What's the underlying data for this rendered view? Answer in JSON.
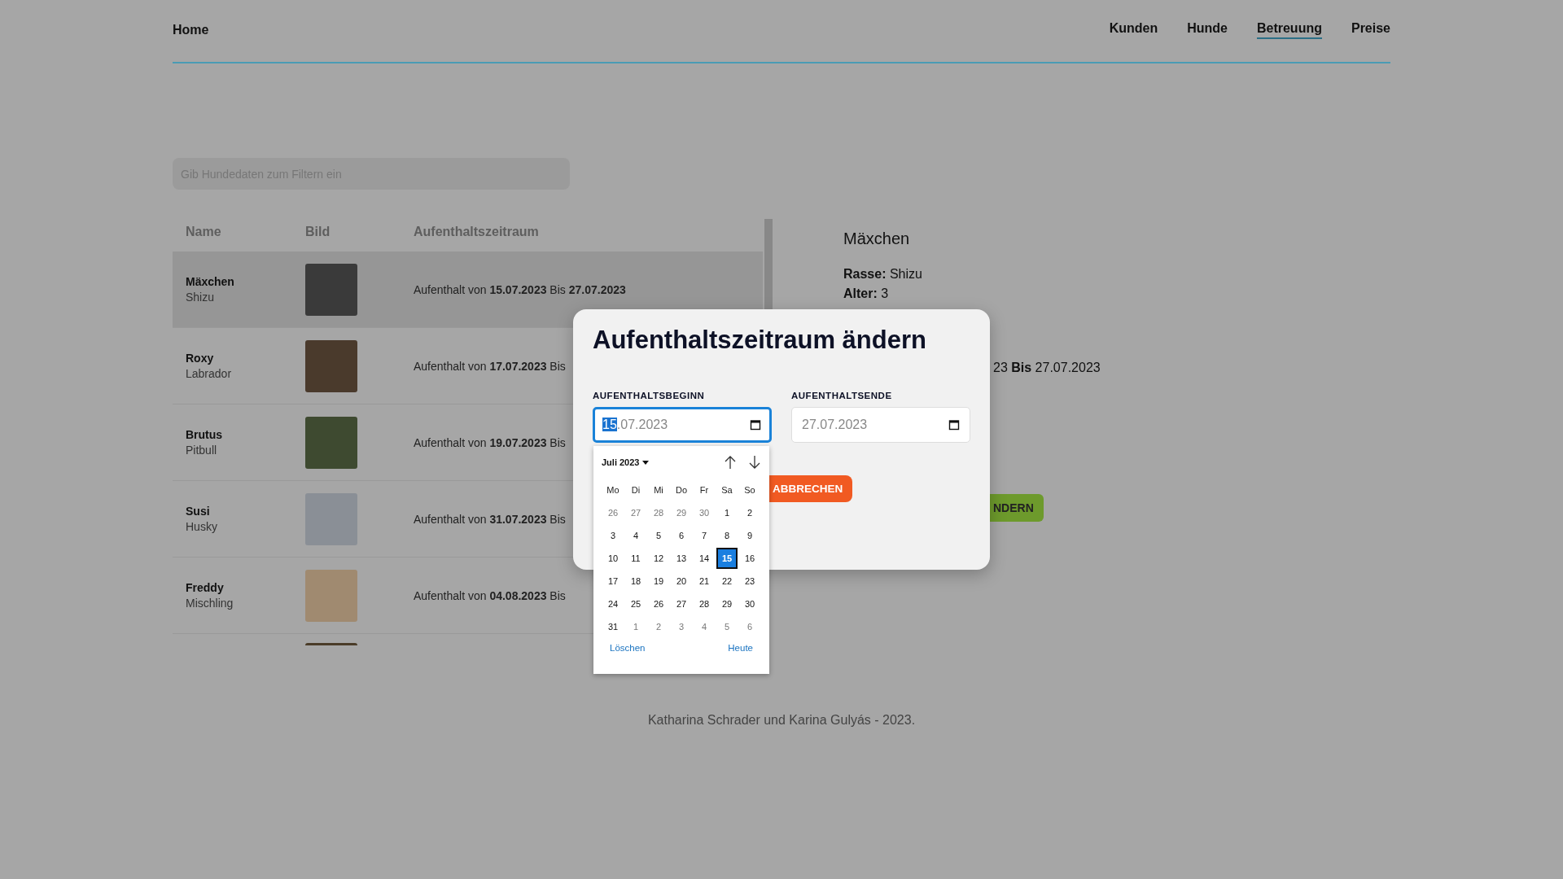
{
  "nav": {
    "home": "Home",
    "links": [
      {
        "label": "Kunden",
        "selected": false
      },
      {
        "label": "Hunde",
        "selected": false
      },
      {
        "label": "Betreuung",
        "selected": true
      },
      {
        "label": "Preise",
        "selected": false
      }
    ]
  },
  "filter": {
    "placeholder": "Gib Hundedaten zum Filtern ein"
  },
  "table": {
    "columns": [
      "Name",
      "Bild",
      "Aufenthaltszeitraum"
    ],
    "rows": [
      {
        "name": "Mäxchen",
        "breed": "Shizu",
        "stay": "Aufenthalt von **15.07.2023** Bis **27.07.2023**",
        "selected": true
      },
      {
        "name": "Roxy",
        "breed": "Labrador",
        "stay": "Aufenthalt von **17.07.2023** Bis",
        "selected": false
      },
      {
        "name": "Brutus",
        "breed": "Pitbull",
        "stay": "Aufenthalt von **19.07.2023** Bis",
        "selected": false
      },
      {
        "name": "Susi",
        "breed": "Husky",
        "stay": "Aufenthalt von **31.07.2023** Bis",
        "selected": false
      },
      {
        "name": "Freddy",
        "breed": "Mischling",
        "stay": "Aufenthalt von **04.08.2023** Bis",
        "selected": false
      }
    ]
  },
  "detail": {
    "name": "Mäxchen",
    "fields": [
      {
        "label": "Rasse:",
        "value": "Shizu"
      },
      {
        "label": "Alter:",
        "value": "3"
      }
    ],
    "stay": "23 **Bis** 27.07.2023",
    "button": "NDERN"
  },
  "modal": {
    "title": "Aufenthaltszeitraum ändern",
    "start": {
      "label": "AUFENTHALTSBEGINN",
      "segments": [
        {
          "text": "15",
          "selected": true
        },
        {
          "text": ".07.2023",
          "selected": false
        }
      ]
    },
    "end": {
      "label": "AUFENTHALTSENDE",
      "segments": [
        {
          "text": "27.07.2023",
          "selected": false
        }
      ]
    },
    "cancel": "ABBRECHEN"
  },
  "calendar": {
    "month": "Juli 2023",
    "weekdays": [
      "Mo",
      "Di",
      "Mi",
      "Do",
      "Fr",
      "Sa",
      "So"
    ],
    "days": [
      {
        "label": "26",
        "outside": true,
        "selected": false
      },
      {
        "label": "27",
        "outside": true,
        "selected": false
      },
      {
        "label": "28",
        "outside": true,
        "selected": false
      },
      {
        "label": "29",
        "outside": true,
        "selected": false
      },
      {
        "label": "30",
        "outside": true,
        "selected": false
      },
      {
        "label": "1",
        "outside": false,
        "selected": false
      },
      {
        "label": "2",
        "outside": false,
        "selected": false
      },
      {
        "label": "3",
        "outside": false,
        "selected": false
      },
      {
        "label": "4",
        "outside": false,
        "selected": false
      },
      {
        "label": "5",
        "outside": false,
        "selected": false
      },
      {
        "label": "6",
        "outside": false,
        "selected": false
      },
      {
        "label": "7",
        "outside": false,
        "selected": false
      },
      {
        "label": "8",
        "outside": false,
        "selected": false
      },
      {
        "label": "9",
        "outside": false,
        "selected": false
      },
      {
        "label": "10",
        "outside": false,
        "selected": false
      },
      {
        "label": "11",
        "outside": false,
        "selected": false
      },
      {
        "label": "12",
        "outside": false,
        "selected": false
      },
      {
        "label": "13",
        "outside": false,
        "selected": false
      },
      {
        "label": "14",
        "outside": false,
        "selected": false
      },
      {
        "label": "15",
        "outside": false,
        "selected": true
      },
      {
        "label": "16",
        "outside": false,
        "selected": false
      },
      {
        "label": "17",
        "outside": false,
        "selected": false
      },
      {
        "label": "18",
        "outside": false,
        "selected": false
      },
      {
        "label": "19",
        "outside": false,
        "selected": false
      },
      {
        "label": "20",
        "outside": false,
        "selected": false
      },
      {
        "label": "21",
        "outside": false,
        "selected": false
      },
      {
        "label": "22",
        "outside": false,
        "selected": false
      },
      {
        "label": "23",
        "outside": false,
        "selected": false
      },
      {
        "label": "24",
        "outside": false,
        "selected": false
      },
      {
        "label": "25",
        "outside": false,
        "selected": false
      },
      {
        "label": "26",
        "outside": false,
        "selected": false
      },
      {
        "label": "27",
        "outside": false,
        "selected": false
      },
      {
        "label": "28",
        "outside": false,
        "selected": false
      },
      {
        "label": "29",
        "outside": false,
        "selected": false
      },
      {
        "label": "30",
        "outside": false,
        "selected": false
      },
      {
        "label": "31",
        "outside": false,
        "selected": false
      },
      {
        "label": "1",
        "outside": true,
        "selected": false
      },
      {
        "label": "2",
        "outside": true,
        "selected": false
      },
      {
        "label": "3",
        "outside": true,
        "selected": false
      },
      {
        "label": "4",
        "outside": true,
        "selected": false
      },
      {
        "label": "5",
        "outside": true,
        "selected": false
      },
      {
        "label": "6",
        "outside": true,
        "selected": false
      }
    ],
    "clear": "Löschen",
    "today": "Heute"
  },
  "footer": "Katharina Schrader und Karina Gulyás - 2023."
}
